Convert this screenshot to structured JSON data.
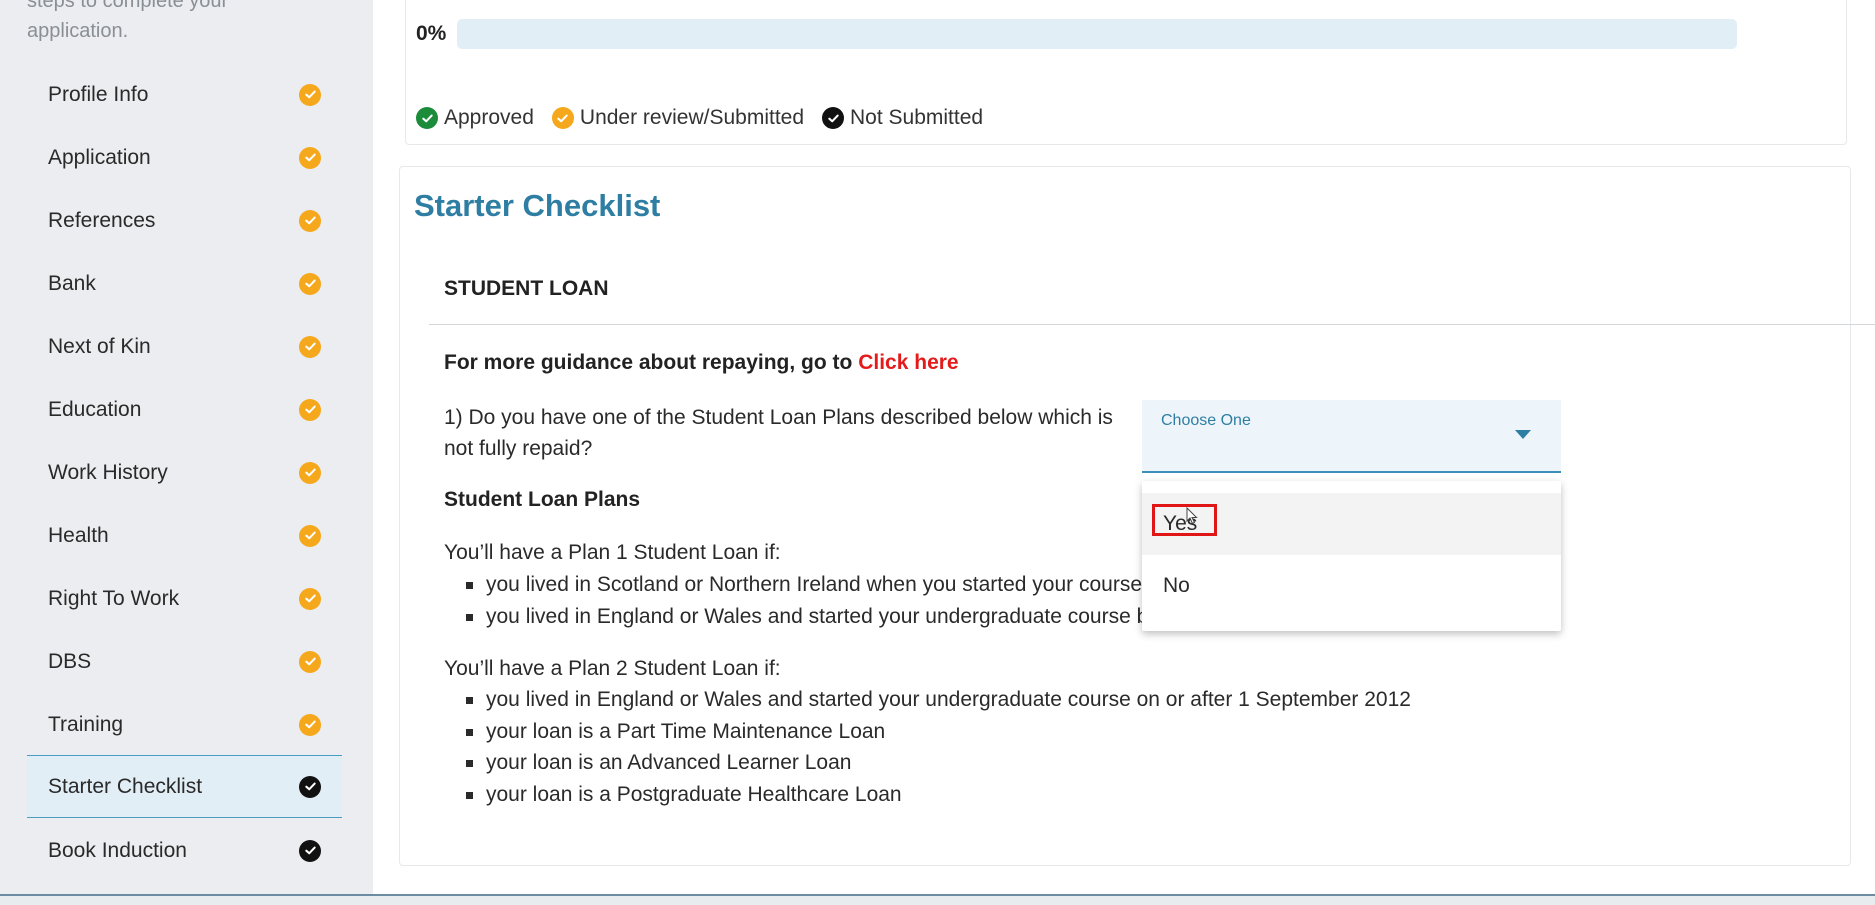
{
  "sidebar": {
    "intro_text": "steps to complete your application.",
    "items": [
      {
        "label": "Profile Info",
        "status": "under-review"
      },
      {
        "label": "Application",
        "status": "under-review"
      },
      {
        "label": "References",
        "status": "under-review"
      },
      {
        "label": "Bank",
        "status": "under-review"
      },
      {
        "label": "Next of Kin",
        "status": "under-review"
      },
      {
        "label": "Education",
        "status": "under-review"
      },
      {
        "label": "Work History",
        "status": "under-review"
      },
      {
        "label": "Health",
        "status": "under-review"
      },
      {
        "label": "Right To Work",
        "status": "under-review"
      },
      {
        "label": "DBS",
        "status": "under-review"
      },
      {
        "label": "Training",
        "status": "under-review"
      },
      {
        "label": "Starter Checklist",
        "status": "not-submitted",
        "active": true
      },
      {
        "label": "Book Induction",
        "status": "not-submitted"
      }
    ]
  },
  "progress": {
    "percent_label": "0%",
    "value": 0,
    "legend": [
      {
        "label": "Approved",
        "color": "#1a8c3a",
        "icon": "check-circle-icon"
      },
      {
        "label": "Under review/Submitted",
        "color": "#f5a81c",
        "icon": "check-circle-icon"
      },
      {
        "label": "Not Submitted",
        "color": "#111111",
        "icon": "check-circle-icon"
      }
    ]
  },
  "checklist": {
    "title": "Starter Checklist",
    "section_title": "STUDENT LOAN",
    "guidance_text": "For more guidance about repaying, go to",
    "guidance_link": "Click here",
    "question": "1) Do you have one of the Student Loan Plans described below which is not fully repaid?",
    "select": {
      "label": "Choose One",
      "options": [
        "Yes",
        "No"
      ],
      "hovered_option": "Yes"
    },
    "plans_title": "Student Loan Plans",
    "plan1_intro": "You’ll have a Plan 1 Student Loan if:",
    "plan1_items": [
      "you lived in Scotland or Northern Ireland when you started your course",
      "you lived in England or Wales and started your undergraduate course b"
    ],
    "plan2_intro": "You’ll have a Plan 2 Student Loan if:",
    "plan2_items": [
      "you lived in England or Wales and started your undergraduate course on or after 1 September 2012",
      "your loan is a Part Time Maintenance Loan",
      "your loan is an Advanced Learner Loan",
      "your loan is a Postgraduate Healthcare Loan"
    ]
  },
  "colors": {
    "accent": "#2e7ea3",
    "link_red": "#e41b1b",
    "status_orange": "#f5a81c",
    "status_black": "#111111",
    "status_green": "#1a8c3a"
  }
}
